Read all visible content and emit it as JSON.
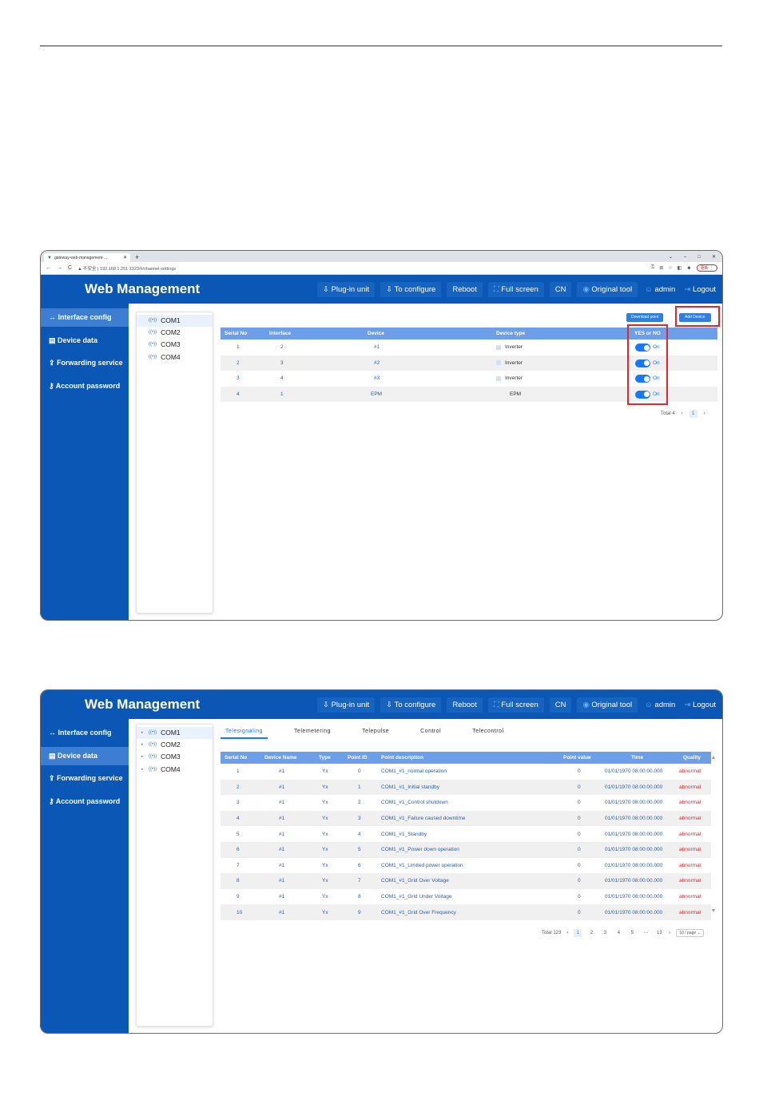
{
  "browser": {
    "tab_title": "gateway-web-management-...",
    "new_tab": "+",
    "window_controls": [
      "⌄",
      "–",
      "□",
      "✕"
    ],
    "nav": [
      "←",
      "→",
      "C"
    ],
    "address": "▲ 不安全 | 192.168.1.251:1323/#/channel-settings",
    "update_label": "更新 ⋮",
    "toolbar_icons": [
      "key-icon",
      "translate-icon",
      "star-icon",
      "sidepanel-icon",
      "profile-icon"
    ]
  },
  "app": {
    "title": "Web Management",
    "nav": {
      "plugin": "⇩ Plug-in unit",
      "configure": "⇩ To configure",
      "reboot": "Reboot",
      "fullscreen": "Full screen",
      "cn": "CN",
      "original_tool": "Original tool",
      "admin": "admin",
      "logout": "Logout"
    },
    "sidebar": [
      {
        "icon": "↔",
        "label": "Interface config"
      },
      {
        "icon": "▤",
        "label": "Device data"
      },
      {
        "icon": "⇪",
        "label": "Forwarding service"
      },
      {
        "icon": "⚷",
        "label": "Account password"
      }
    ],
    "tree": [
      "COM1",
      "COM2",
      "COM3",
      "COM4"
    ]
  },
  "screen1": {
    "download_btn": "Download point",
    "add_btn": "Add Device",
    "columns": [
      "Serial No",
      "Interface",
      "Device",
      "Device type",
      "YES or NO"
    ],
    "rows": [
      {
        "serial": "1",
        "interface": "2",
        "device": "#1",
        "type": "Inverter",
        "enabled": "On"
      },
      {
        "serial": "2",
        "interface": "3",
        "device": "#2",
        "type": "Inverter",
        "enabled": "On"
      },
      {
        "serial": "3",
        "interface": "4",
        "device": "#3",
        "type": "Inverter",
        "enabled": "On"
      },
      {
        "serial": "4",
        "interface": "1",
        "device": "EPM",
        "type": "EPM",
        "enabled": "On"
      }
    ],
    "pager": {
      "total": "Total 4",
      "prev": "‹",
      "page": "1",
      "next": "›"
    }
  },
  "screen2": {
    "tabs": [
      "Telesignaling",
      "Telemetering",
      "Telepulse",
      "Control",
      "Telecontrol"
    ],
    "columns": [
      "Serial No",
      "Device Name",
      "Type",
      "Point ID",
      "Point description",
      "Point value",
      "Time",
      "Quality"
    ],
    "rows": [
      {
        "serial": "1",
        "name": "#1",
        "type": "Yx",
        "pid": "0",
        "desc": "COM1_#1_normal operation",
        "value": "0",
        "time": "01/01/1970 08:00:00.000",
        "quality": "abnormal"
      },
      {
        "serial": "2",
        "name": "#1",
        "type": "Yx",
        "pid": "1",
        "desc": "COM1_#1_Initial standby",
        "value": "0",
        "time": "01/01/1970 08:00:00.000",
        "quality": "abnormal"
      },
      {
        "serial": "3",
        "name": "#1",
        "type": "Yx",
        "pid": "2",
        "desc": "COM1_#1_Control shutdown",
        "value": "0",
        "time": "01/01/1970 08:00:00.000",
        "quality": "abnormal"
      },
      {
        "serial": "4",
        "name": "#1",
        "type": "Yx",
        "pid": "3",
        "desc": "COM1_#1_Failure caused downtime",
        "value": "0",
        "time": "01/01/1970 08:00:00.000",
        "quality": "abnormal"
      },
      {
        "serial": "5",
        "name": "#1",
        "type": "Yx",
        "pid": "4",
        "desc": "COM1_#1_Standby",
        "value": "0",
        "time": "01/01/1970 08:00:00.000",
        "quality": "abnormal"
      },
      {
        "serial": "6",
        "name": "#1",
        "type": "Yx",
        "pid": "5",
        "desc": "COM1_#1_Power down operation",
        "value": "0",
        "time": "01/01/1970 08:00:00.000",
        "quality": "abnormal"
      },
      {
        "serial": "7",
        "name": "#1",
        "type": "Yx",
        "pid": "6",
        "desc": "COM1_#1_Limited power operation",
        "value": "0",
        "time": "01/01/1970 08:00:00.000",
        "quality": "abnormal"
      },
      {
        "serial": "8",
        "name": "#1",
        "type": "Yx",
        "pid": "7",
        "desc": "COM1_#1_Grid Over Voltage",
        "value": "0",
        "time": "01/01/1970 08:00:00.000",
        "quality": "abnormal"
      },
      {
        "serial": "9",
        "name": "#1",
        "type": "Yx",
        "pid": "8",
        "desc": "COM1_#1_Grid Under Voltage",
        "value": "0",
        "time": "01/01/1970 08:00:00.000",
        "quality": "abnormal"
      },
      {
        "serial": "10",
        "name": "#1",
        "type": "Yx",
        "pid": "9",
        "desc": "COM1_#1_Grid Over Frequency",
        "value": "0",
        "time": "01/01/1970 08:00:00.000",
        "quality": "abnormal"
      }
    ],
    "pager": {
      "total": "Total 123",
      "prev": "‹",
      "pages": [
        "1",
        "2",
        "3",
        "4",
        "5",
        "···",
        "13"
      ],
      "next": "›",
      "size": "10 / page ⌄"
    }
  },
  "colors": {
    "primary": "#0a57b5",
    "accent": "#1677ff",
    "header_row": "#6c9fe8",
    "highlight": "#e3262b"
  }
}
